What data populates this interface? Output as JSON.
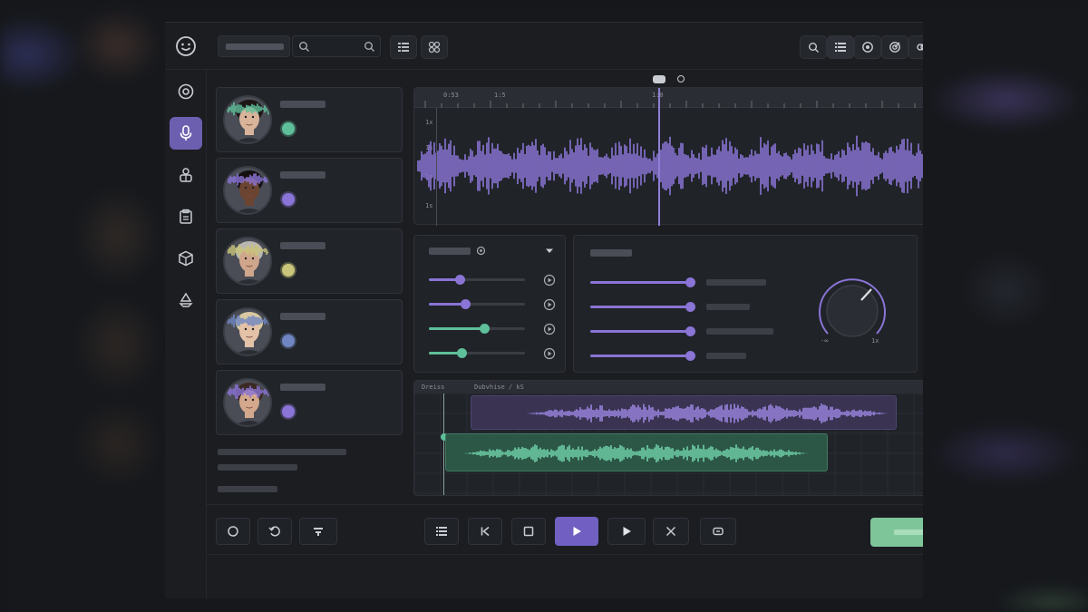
{
  "colors": {
    "accent_purple": "#8a74d6",
    "accent_green": "#5fbf9a",
    "accent_yellow": "#c9c57a",
    "accent_blue": "#6f86c2",
    "panel_bg": "#202328",
    "window_bg": "#1b1d21"
  },
  "topbar": {
    "logo_icon": "smiley-icon",
    "left_tools": [
      "list-icon",
      "grid-icon"
    ],
    "right_tools": [
      "search-icon",
      "list-icon",
      "camera-icon",
      "target-icon",
      "link-icon"
    ]
  },
  "sidebar": {
    "items": [
      {
        "icon": "record-icon",
        "active": false
      },
      {
        "icon": "microphone-icon",
        "active": true
      },
      {
        "icon": "robot-icon",
        "active": false
      },
      {
        "icon": "clipboard-icon",
        "active": false
      },
      {
        "icon": "package-icon",
        "active": false
      },
      {
        "icon": "recycle-icon",
        "active": false
      }
    ]
  },
  "voices": [
    {
      "color": "#5fbf9a",
      "skin": "#d9b49a",
      "hair": "#1d1615"
    },
    {
      "color": "#8a74d6",
      "skin": "#6b4532",
      "hair": "#141010"
    },
    {
      "color": "#c9c57a",
      "skin": "#cfa58c",
      "hair": "#b9b6b2"
    },
    {
      "color": "#6f86c2",
      "skin": "#e3c2a8",
      "hair": "#d9c9a2"
    },
    {
      "color": "#8a74d6",
      "skin": "#d4a88c",
      "hair": "#3a2a22"
    }
  ],
  "waveform": {
    "ruler_labels": [
      "0:53",
      "1:5",
      "1:0"
    ],
    "y_labels": [
      "1x",
      "1s",
      "1s",
      "1s"
    ]
  },
  "effects": {
    "sliders": [
      {
        "value": 0.32,
        "color": "#8a74d6"
      },
      {
        "value": 0.38,
        "color": "#8a74d6"
      },
      {
        "value": 0.58,
        "color": "#5fbf9a"
      },
      {
        "value": 0.34,
        "color": "#5fbf9a"
      }
    ]
  },
  "mix": {
    "sliders": [
      {
        "value": 1.0,
        "color": "#8a74d6"
      },
      {
        "value": 1.0,
        "color": "#8a74d6"
      },
      {
        "value": 1.0,
        "color": "#8a74d6"
      },
      {
        "value": 1.0,
        "color": "#8a74d6"
      }
    ],
    "knob_labels": [
      "-∞",
      "1x"
    ]
  },
  "tracks": {
    "header_label": "Dreiss",
    "clip_label": "Dubvhise / kS"
  },
  "transport": {
    "left": [
      "circle-icon",
      "undo-icon",
      "split-icon"
    ],
    "center": [
      "list-icon",
      "skip-back-icon",
      "stop-icon",
      "play-icon",
      "play-next-icon",
      "shuffle-icon",
      "loop-icon"
    ]
  }
}
